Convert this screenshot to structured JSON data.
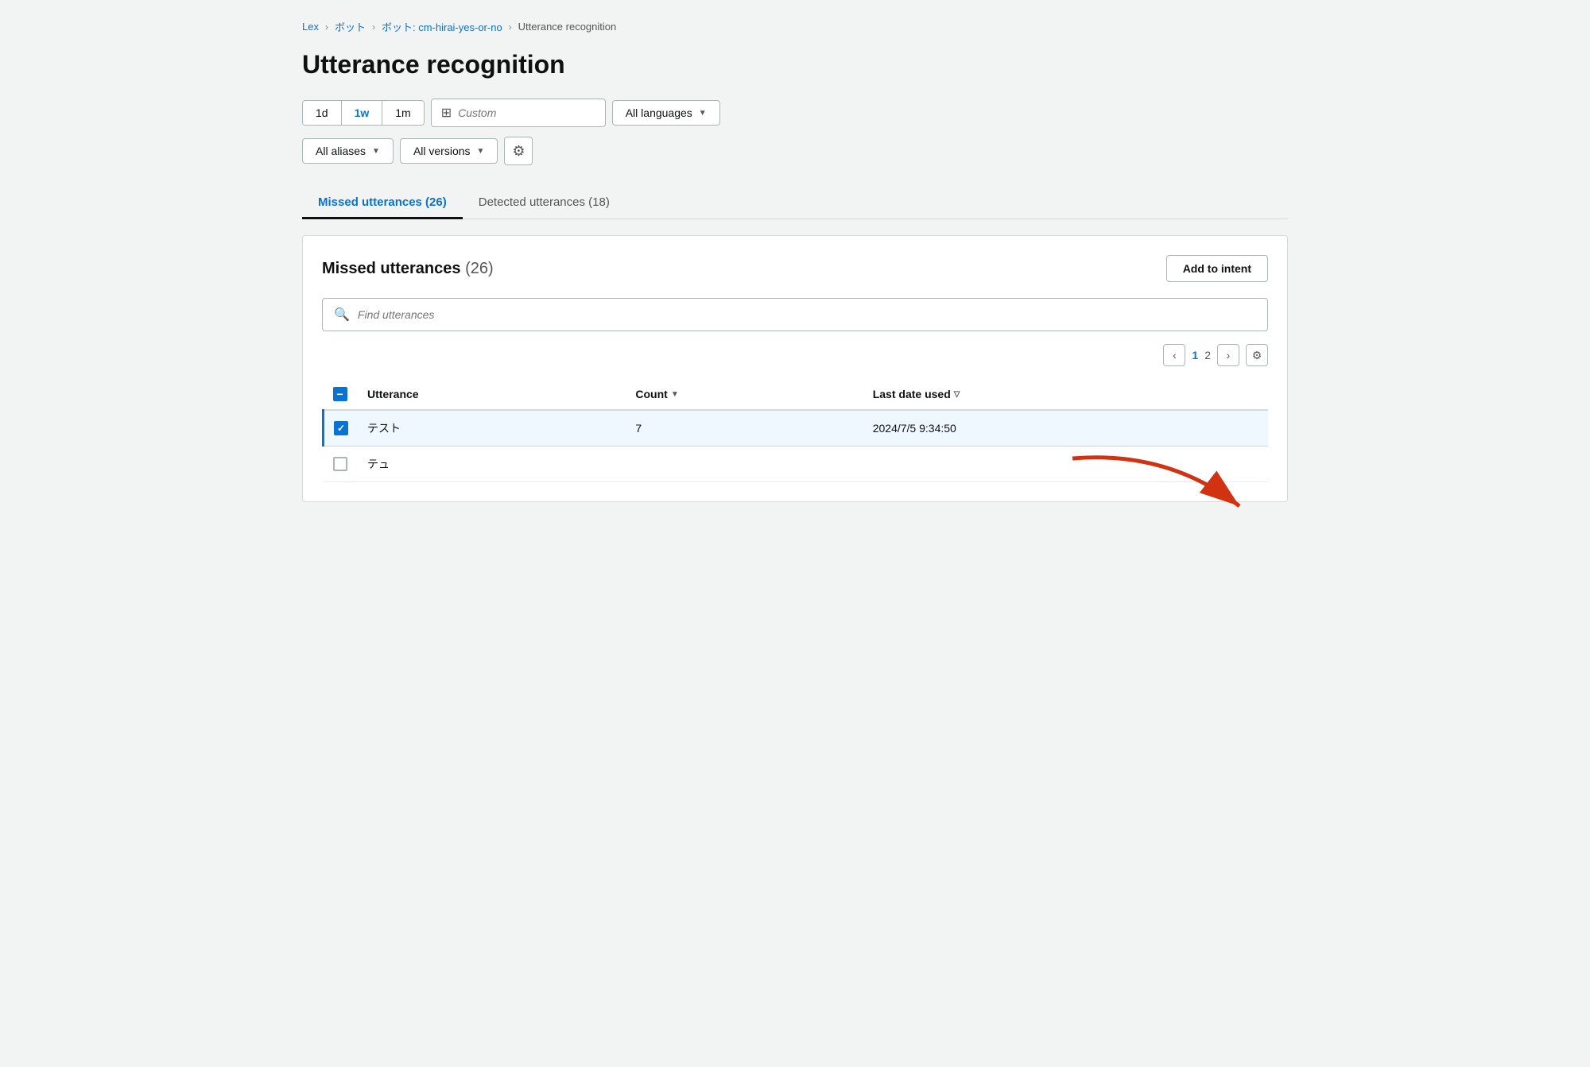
{
  "breadcrumb": {
    "items": [
      {
        "label": "Lex",
        "href": "#",
        "type": "link"
      },
      {
        "label": "ボット",
        "href": "#",
        "type": "link"
      },
      {
        "label": "ボット: cm-hirai-yes-or-no",
        "href": "#",
        "type": "link"
      },
      {
        "label": "Utterance recognition",
        "type": "current"
      }
    ],
    "separator": "›"
  },
  "page": {
    "title": "Utterance recognition"
  },
  "filters": {
    "time_buttons": [
      {
        "label": "1d",
        "active": false
      },
      {
        "label": "1w",
        "active": true
      },
      {
        "label": "1m",
        "active": false
      }
    ],
    "custom_placeholder": "Custom",
    "language_dropdown": "All languages",
    "aliases_dropdown": "All aliases",
    "versions_dropdown": "All versions"
  },
  "tabs": [
    {
      "label": "Missed utterances (26)",
      "active": true
    },
    {
      "label": "Detected utterances (18)",
      "active": false
    }
  ],
  "missed_utterances": {
    "title": "Missed utterances",
    "count": "(26)",
    "add_intent_label": "Add to intent",
    "search_placeholder": "Find utterances",
    "pagination": {
      "current_page": 1,
      "total_pages": 2,
      "prev_label": "‹",
      "next_label": "›"
    },
    "table": {
      "headers": [
        {
          "key": "checkbox",
          "label": ""
        },
        {
          "key": "utterance",
          "label": "Utterance"
        },
        {
          "key": "count",
          "label": "Count",
          "sortable": true,
          "sort_dir": "desc"
        },
        {
          "key": "last_date",
          "label": "Last date used",
          "sortable": true,
          "sort_dir": "desc"
        }
      ],
      "rows": [
        {
          "id": 1,
          "selected": true,
          "utterance": "テスト",
          "count": "7",
          "last_date": "2024/7/5 9:34:50"
        },
        {
          "id": 2,
          "selected": false,
          "utterance": "テュ",
          "count": "",
          "last_date": ""
        }
      ]
    }
  }
}
